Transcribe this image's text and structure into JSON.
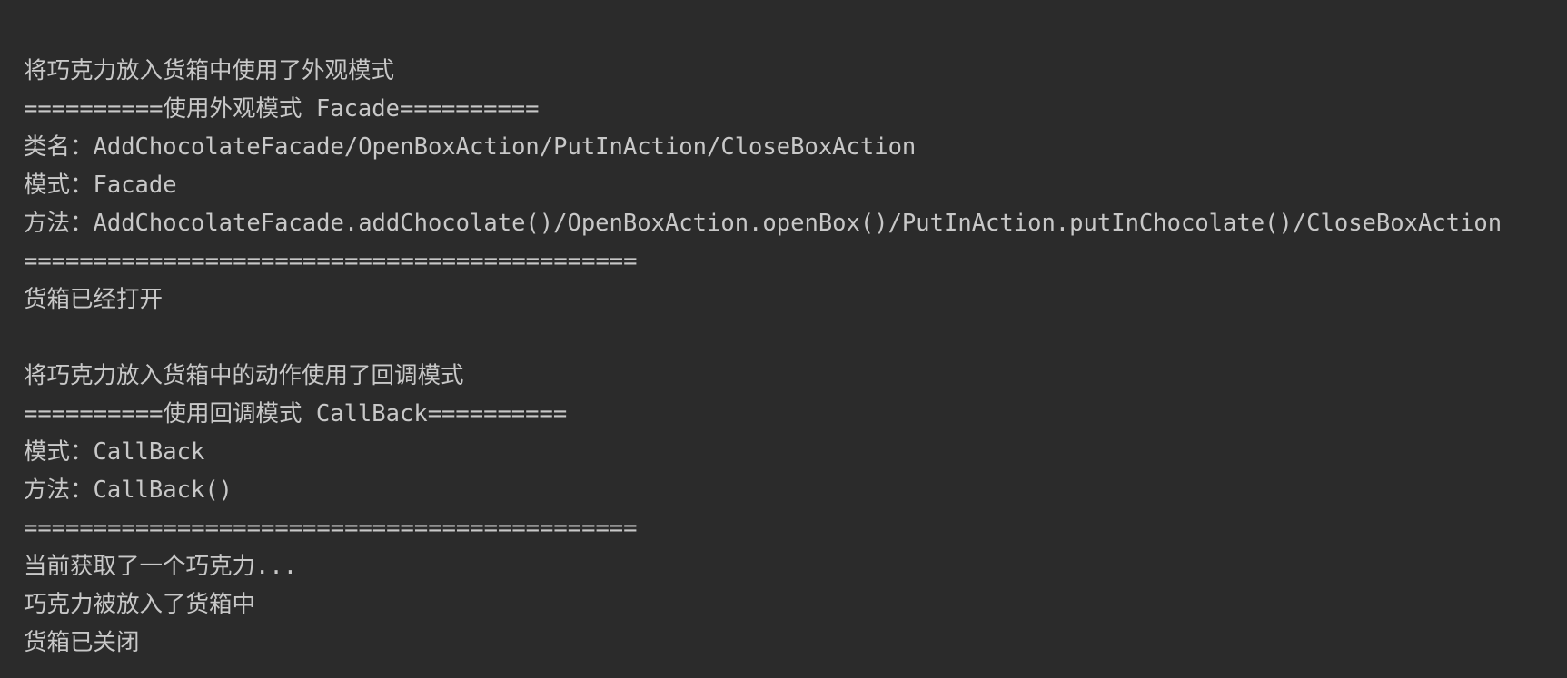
{
  "console": {
    "lines": [
      "将巧克力放入货箱中使用了外观模式",
      "==========使用外观模式 Facade==========",
      "类名：AddChocolateFacade/OpenBoxAction/PutInAction/CloseBoxAction",
      "模式：Facade",
      "方法：AddChocolateFacade.addChocolate()/OpenBoxAction.openBox()/PutInAction.putInChocolate()/CloseBoxAction",
      "============================================",
      "货箱已经打开",
      "",
      "将巧克力放入货箱中的动作使用了回调模式",
      "==========使用回调模式 CallBack==========",
      "模式：CallBack",
      "方法：CallBack()",
      "============================================",
      "当前获取了一个巧克力...",
      "巧克力被放入了货箱中",
      "货箱已关闭"
    ]
  }
}
